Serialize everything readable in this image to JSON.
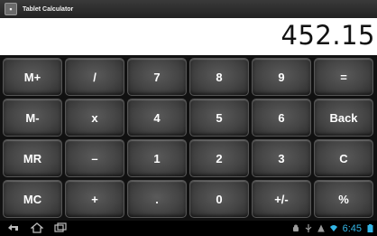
{
  "app": {
    "title": "Tablet Calculator",
    "icon": "calculator-app-icon"
  },
  "display": {
    "value": "452.15"
  },
  "keys": [
    [
      "M+",
      "/",
      "7",
      "8",
      "9",
      "="
    ],
    [
      "M-",
      "x",
      "4",
      "5",
      "6",
      "Back"
    ],
    [
      "MR",
      "–",
      "1",
      "2",
      "3",
      "C"
    ],
    [
      "MC",
      "+",
      ".",
      "0",
      "+/-",
      "%"
    ]
  ],
  "status": {
    "time": "6:45"
  },
  "colors": {
    "clock": "#33b5e5",
    "display_bg": "#ffffff",
    "key_bg": "#444444"
  }
}
